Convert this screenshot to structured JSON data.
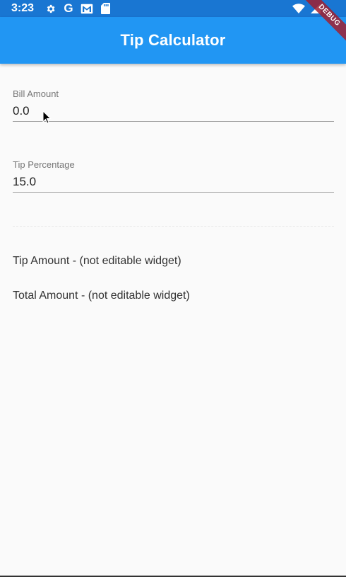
{
  "status_bar": {
    "time": "3:23",
    "left_icons": [
      "gear-icon",
      "google-icon",
      "gmail-icon",
      "sd-card-icon"
    ],
    "right_icons": [
      "wifi-icon",
      "signal-icon"
    ],
    "google_letter": "G"
  },
  "debug_banner": {
    "label": "DEBUG"
  },
  "app_bar": {
    "title": "Tip Calculator"
  },
  "form": {
    "bill_amount": {
      "label": "Bill Amount",
      "value": "0.0"
    },
    "tip_percentage": {
      "label": "Tip Percentage",
      "value": "15.0"
    }
  },
  "results": {
    "tip_amount": "Tip Amount - (not editable widget)",
    "total_amount": "Total Amount - (not editable widget)"
  },
  "colors": {
    "app_bar": "#2196f3",
    "status_bar": "#1976d2",
    "background": "#fafafa",
    "debug_banner": "#a02030"
  }
}
